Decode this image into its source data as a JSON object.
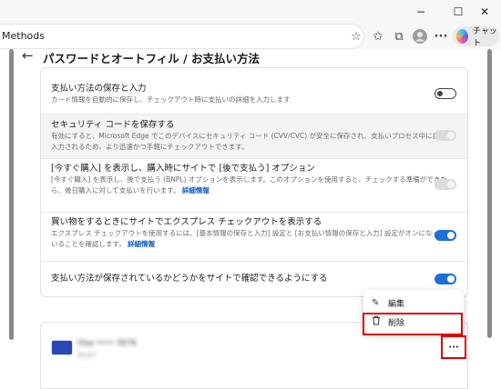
{
  "window": {
    "minimize": "−",
    "maximize": "☐",
    "close": "✕"
  },
  "address_bar": {
    "url_text": "Methods",
    "chat_label": "チャット"
  },
  "page": {
    "title": "パスワードとオートフィル / お支払い方法"
  },
  "settings": [
    {
      "title": "支払い方法の保存と入力",
      "desc": "カード情報を自動的に保存し、チェックアウト時に支払いの詳細を入力します",
      "toggle": "off"
    },
    {
      "title": "セキュリティ コードを保存する",
      "desc": "有効にすると、Microsoft Edge でこのデバイスにセキュリティ コード (CVV/CVC) が安全に保存され、支払いプロセス中に自動入力されるため、より迅速かつ手軽にチェックアウトできます。",
      "toggle": "disabled"
    },
    {
      "title": "[今すぐ購入] を表示し、購入時にサイトで [後で支払う] オプション",
      "desc": "[今すぐ購入] を表示し、後で支払う (BNPL) オプションを表示します。このオプションを使用すると、チェックする準備ができたら、後日購入に対して支払いを行います。",
      "link": "詳細情報",
      "toggle": "disabled"
    },
    {
      "title": "買い物をするときにサイトでエクスプレス チェックアウトを表示する",
      "desc": "エクスプレス チェックアウトを使用するには、[基本情報の保存と入力] 設定と [お支払い情報の保存と入力] 設定がオンになっていることを確認します。",
      "link": "詳細情報",
      "toggle": "on"
    },
    {
      "title": "支払い方法が保存されているかどうかをサイトで確認できるようにする",
      "toggle": "on"
    }
  ],
  "menu": {
    "edit": "編集",
    "delete": "削除"
  },
  "payment_card": {
    "name": "Visa •••• 5678",
    "expiry": "01/27",
    "more": "···"
  },
  "colors": {
    "accent": "#1e6fd9",
    "highlight": "#e00000"
  }
}
